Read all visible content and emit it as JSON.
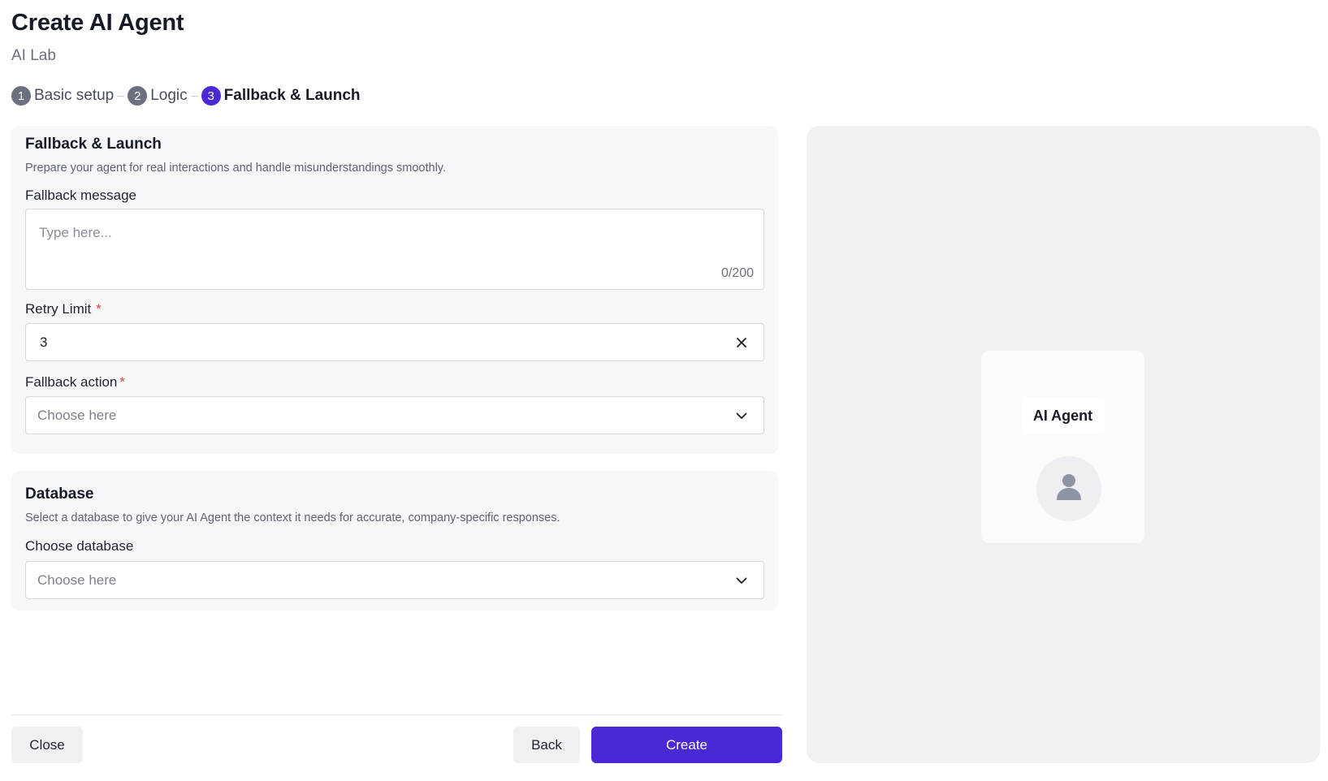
{
  "header": {
    "title": "Create AI Agent",
    "subtitle": "AI Lab"
  },
  "stepper": {
    "steps": [
      {
        "number": "1",
        "label": "Basic setup",
        "active": false
      },
      {
        "number": "2",
        "label": "Logic",
        "active": false
      },
      {
        "number": "3",
        "label": "Fallback & Launch",
        "active": true
      }
    ]
  },
  "fallback_section": {
    "title": "Fallback & Launch",
    "description": "Prepare your agent for real interactions and handle misunderstandings smoothly.",
    "fallback_message": {
      "label": "Fallback message",
      "placeholder": "Type here...",
      "value": "",
      "counter": "0/200"
    },
    "retry_limit": {
      "label": "Retry Limit",
      "required_mark": "*",
      "value": "3"
    },
    "fallback_action": {
      "label": "Fallback action",
      "required_mark": "*",
      "placeholder": "Choose here"
    }
  },
  "database_section": {
    "title": "Database",
    "description": "Select a database to give your AI Agent the context it needs for accurate, company-specific responses.",
    "choose_database": {
      "label": "Choose database",
      "placeholder": "Choose here"
    }
  },
  "footer": {
    "close_label": "Close",
    "back_label": "Back",
    "create_label": "Create"
  },
  "preview": {
    "agent_name": "AI Agent"
  },
  "colors": {
    "accent": "#4a28d6",
    "required": "#e0443a",
    "step_inactive": "#6b7080"
  },
  "icons": {
    "clear": "close-icon",
    "dropdown": "chevron-down-icon",
    "avatar": "user-icon"
  }
}
